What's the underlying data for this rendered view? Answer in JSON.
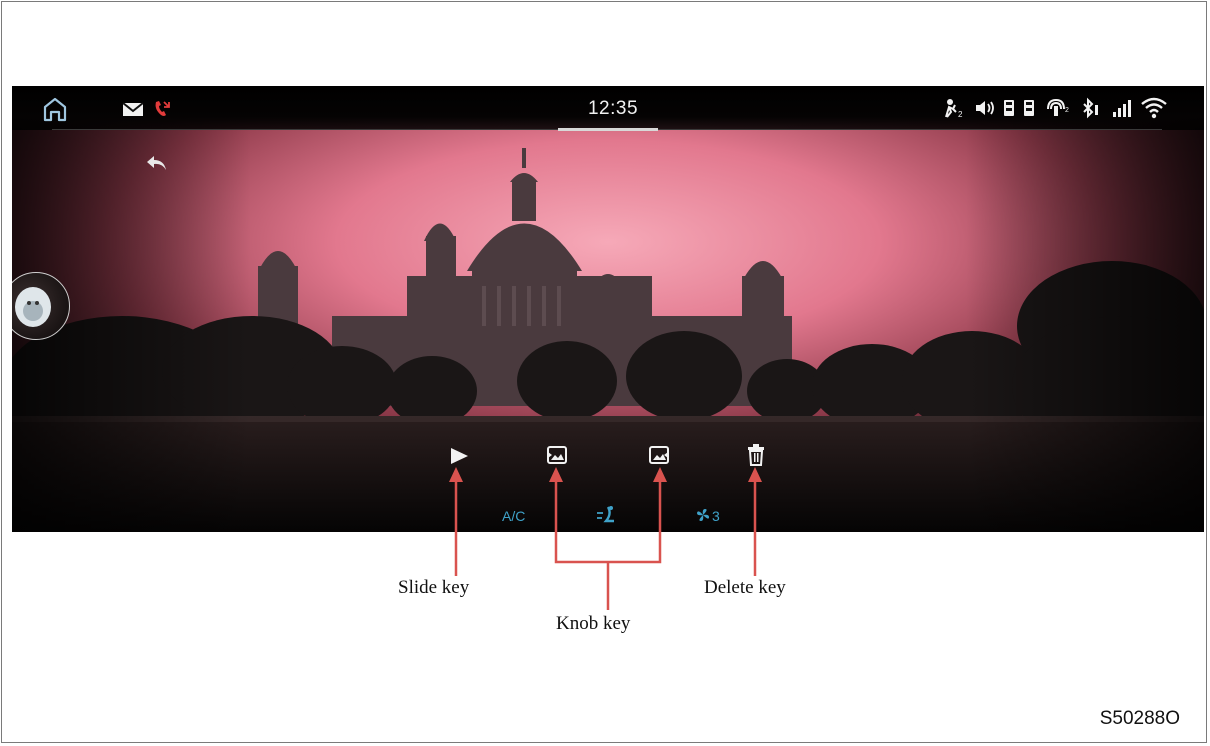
{
  "status_bar": {
    "time": "12:35",
    "left_icons": [
      "home-icon",
      "mail-icon",
      "missed-call-icon"
    ],
    "right_icons": [
      "driver-profile-icon",
      "volume-icon",
      "usb-icon",
      "usb-icon",
      "wireless-charging-icon",
      "bluetooth-icon",
      "cellular-signal-icon",
      "wifi-icon"
    ],
    "accent_missed_call": "#e23b3b"
  },
  "photo_viewer": {
    "back_icon": "back-arrow-icon",
    "controls": [
      "play-icon",
      "previous-picture-icon",
      "next-picture-icon",
      "trash-icon"
    ]
  },
  "hvac_bar": {
    "ac_label": "A/C",
    "airflow_icon": "airflow-seat-icon",
    "fan_icon": "fan-icon",
    "fan_speed": "3",
    "accent": "#3fa2c9"
  },
  "callouts": {
    "slide_key": "Slide key",
    "knob_key": "Knob key",
    "delete_key": "Delete key",
    "arrow_color": "#d9534f"
  },
  "figure_code": "S50288O"
}
